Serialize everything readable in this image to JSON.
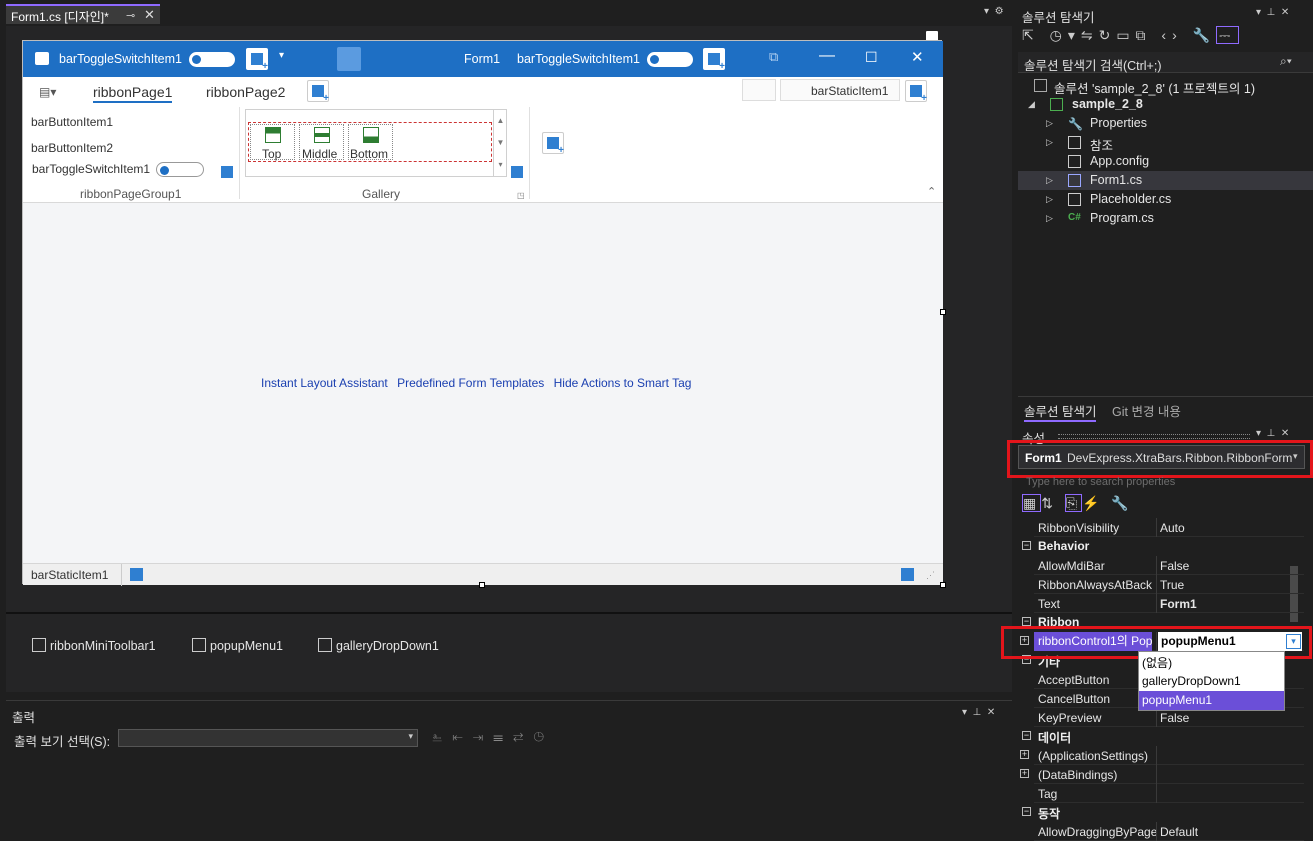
{
  "document_tab": {
    "title": "Form1.cs [디자인]*",
    "pin": "⊸",
    "close": "✕"
  },
  "form": {
    "titlebar": {
      "left_item": "barToggleSwitchItem1",
      "title": "Form1",
      "right_item": "barToggleSwitchItem1"
    },
    "ribbon_tabs": [
      "ribbonPage1",
      "ribbonPage2"
    ],
    "header_item": "barStaticItem1",
    "group1": {
      "items": [
        "barButtonItem1",
        "barButtonItem2",
        "barToggleSwitchItem1"
      ],
      "caption": "ribbonPageGroup1"
    },
    "gallery": {
      "items": [
        "Top",
        "Middle",
        "Bottom"
      ],
      "caption": "Gallery"
    },
    "smart_links": [
      "Instant Layout Assistant",
      "Predefined Form Templates",
      "Hide Actions to Smart Tag"
    ],
    "status_item": "barStaticItem1"
  },
  "component_tray": [
    "ribbonMiniToolbar1",
    "popupMenu1",
    "galleryDropDown1"
  ],
  "output": {
    "title": "출력",
    "label": "출력 보기 선택(S):"
  },
  "solution_explorer": {
    "title": "솔루션 탐색기",
    "search_placeholder": "솔루션 탐색기 검색(Ctrl+;)",
    "solution": "솔루션 'sample_2_8'  (1 프로젝트의 1)",
    "project": "sample_2_8",
    "items": [
      "Properties",
      "참조",
      "App.config",
      "Form1.cs",
      "Placeholder.cs",
      "Program.cs"
    ],
    "bottom_tabs": [
      "솔루션 탐색기",
      "Git 변경 내용"
    ]
  },
  "properties": {
    "title": "속성",
    "object_name": "Form1",
    "object_type": "DevExpress.XtraBars.Ribbon.RibbonForm",
    "search_placeholder": "Type here to search properties",
    "rows": [
      {
        "type": "prop",
        "name": "RibbonVisibility",
        "value": "Auto"
      },
      {
        "type": "cat",
        "name": "Behavior"
      },
      {
        "type": "prop",
        "name": "AllowMdiBar",
        "value": "False"
      },
      {
        "type": "prop",
        "name": "RibbonAlwaysAtBack",
        "value": "True"
      },
      {
        "type": "prop",
        "name": "Text",
        "value": "Form1"
      },
      {
        "type": "cat",
        "name": "Ribbon"
      },
      {
        "type": "prop-sel",
        "name": "ribbonControl1의 Pop",
        "value": "popupMenu1"
      },
      {
        "type": "cat",
        "name": "기타"
      },
      {
        "type": "prop",
        "name": "AcceptButton",
        "value": ""
      },
      {
        "type": "prop",
        "name": "CancelButton",
        "value": ""
      },
      {
        "type": "prop",
        "name": "KeyPreview",
        "value": "False"
      },
      {
        "type": "cat",
        "name": "데이터"
      },
      {
        "type": "prop-exp",
        "name": "(ApplicationSettings)",
        "value": ""
      },
      {
        "type": "prop-exp",
        "name": "(DataBindings)",
        "value": ""
      },
      {
        "type": "prop",
        "name": "Tag",
        "value": ""
      },
      {
        "type": "cat",
        "name": "동작"
      },
      {
        "type": "prop",
        "name": "AllowDraggingByPage",
        "value": "Default"
      }
    ],
    "dropdown_options": [
      "(없음)",
      "galleryDropDown1",
      "popupMenu1"
    ],
    "dropdown_selected": "popupMenu1"
  },
  "colors": {
    "accent": "#8f6aff",
    "highlight": "#e3151b",
    "form_blue": "#1e6fc4",
    "selected": "#6b4fd8"
  }
}
